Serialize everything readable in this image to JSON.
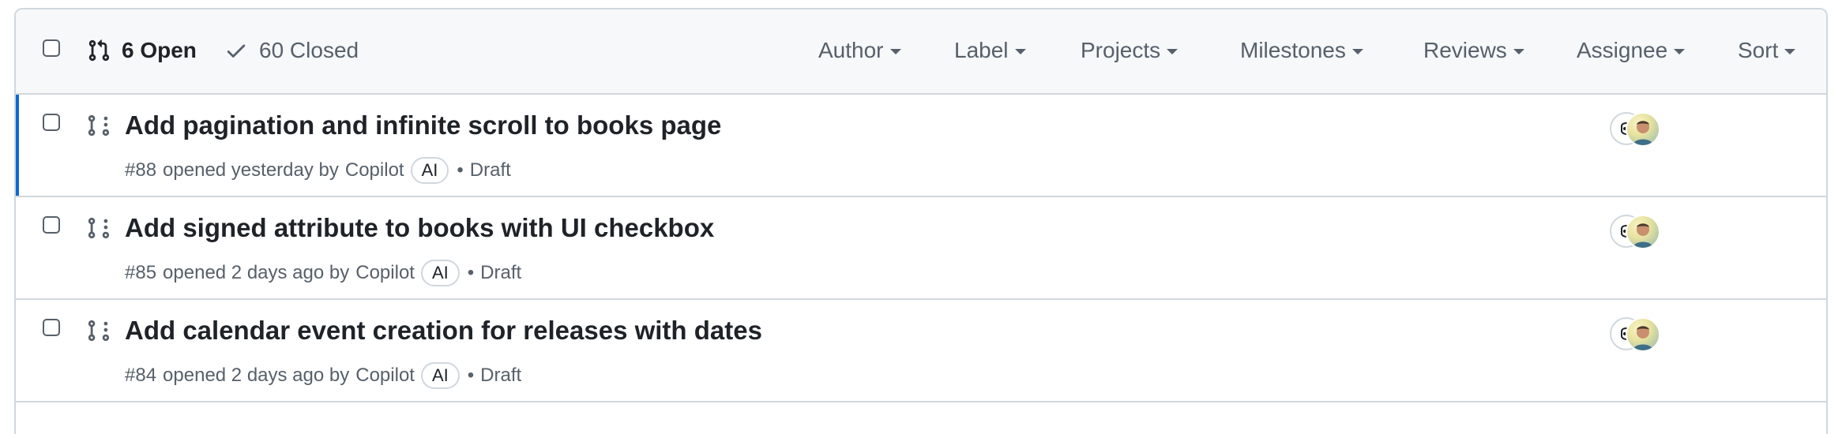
{
  "header": {
    "open_label": "6 Open",
    "closed_label": "60 Closed",
    "filters": [
      "Author",
      "Label",
      "Projects",
      "Milestones",
      "Reviews",
      "Assignee",
      "Sort"
    ]
  },
  "pull_requests": [
    {
      "title": "Add pagination and infinite scroll to books page",
      "number": "#88",
      "opened": "opened yesterday by",
      "author": "Copilot",
      "badge": "AI",
      "status": "Draft"
    },
    {
      "title": "Add signed attribute to books with UI checkbox",
      "number": "#85",
      "opened": "opened 2 days ago by",
      "author": "Copilot",
      "badge": "AI",
      "status": "Draft"
    },
    {
      "title": "Add calendar event creation for releases with dates",
      "number": "#84",
      "opened": "opened 2 days ago by",
      "author": "Copilot",
      "badge": "AI",
      "status": "Draft"
    }
  ],
  "icons": {
    "open": "git-pull-request-icon",
    "closed": "check-icon",
    "row": "git-pull-request-draft-icon",
    "assignee_avatars": [
      "copilot-avatar",
      "user-avatar"
    ]
  },
  "colors": {
    "accent": "#0969da",
    "border": "#d0d7de",
    "header_bg": "#f6f8fa",
    "muted_text": "#57606a",
    "text": "#1f2328"
  }
}
